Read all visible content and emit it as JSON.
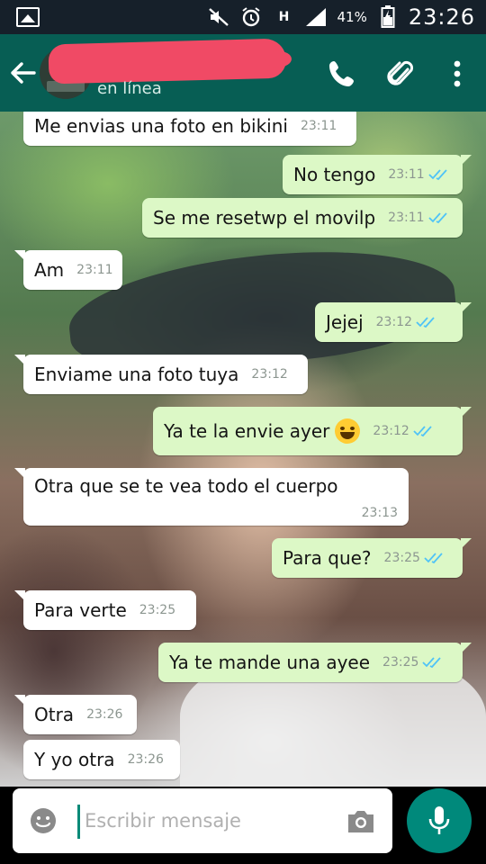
{
  "status_bar": {
    "battery_percent": "41%",
    "network_label": "H",
    "time": "23:26"
  },
  "header": {
    "contact_status": "en línea",
    "icons": [
      "back-arrow",
      "phone",
      "paperclip",
      "overflow-menu"
    ]
  },
  "messages": [
    {
      "dir": "in",
      "text": "Me envias una foto en bikini",
      "time": "23:11",
      "read": false
    },
    {
      "dir": "out",
      "text": "No tengo",
      "time": "23:11",
      "read": true
    },
    {
      "dir": "out",
      "text": "Se me resetwp el movilp",
      "time": "23:11",
      "read": true
    },
    {
      "dir": "in",
      "text": "Am",
      "time": "23:11",
      "read": false
    },
    {
      "dir": "out",
      "text": "Jejej",
      "time": "23:12",
      "read": true
    },
    {
      "dir": "in",
      "text": "Enviame una foto tuya",
      "time": "23:12",
      "read": false
    },
    {
      "dir": "out",
      "text": "Ya te la envie ayer",
      "emoji": "grinning-sweat",
      "time": "23:12",
      "read": true
    },
    {
      "dir": "in",
      "text": "Otra que se te vea todo el cuerpo",
      "time": "23:13",
      "read": false
    },
    {
      "dir": "out",
      "text": "Para que?",
      "time": "23:25",
      "read": true
    },
    {
      "dir": "in",
      "text": "Para verte",
      "time": "23:25",
      "read": false
    },
    {
      "dir": "out",
      "text": "Ya te mande una ayee",
      "time": "23:25",
      "read": true
    },
    {
      "dir": "in",
      "text": "Otra",
      "time": "23:26",
      "read": false
    },
    {
      "dir": "in",
      "text": "Y yo otra",
      "time": "23:26",
      "read": false
    }
  ],
  "composer": {
    "placeholder": "Escribir mensaje"
  },
  "colors": {
    "header": "#075e54",
    "outgoing_bubble": "#dcf8c6",
    "incoming_bubble": "#ffffff",
    "read_ticks": "#4fc3f7",
    "mic_button": "#00897b",
    "redaction": "#f04a65"
  }
}
